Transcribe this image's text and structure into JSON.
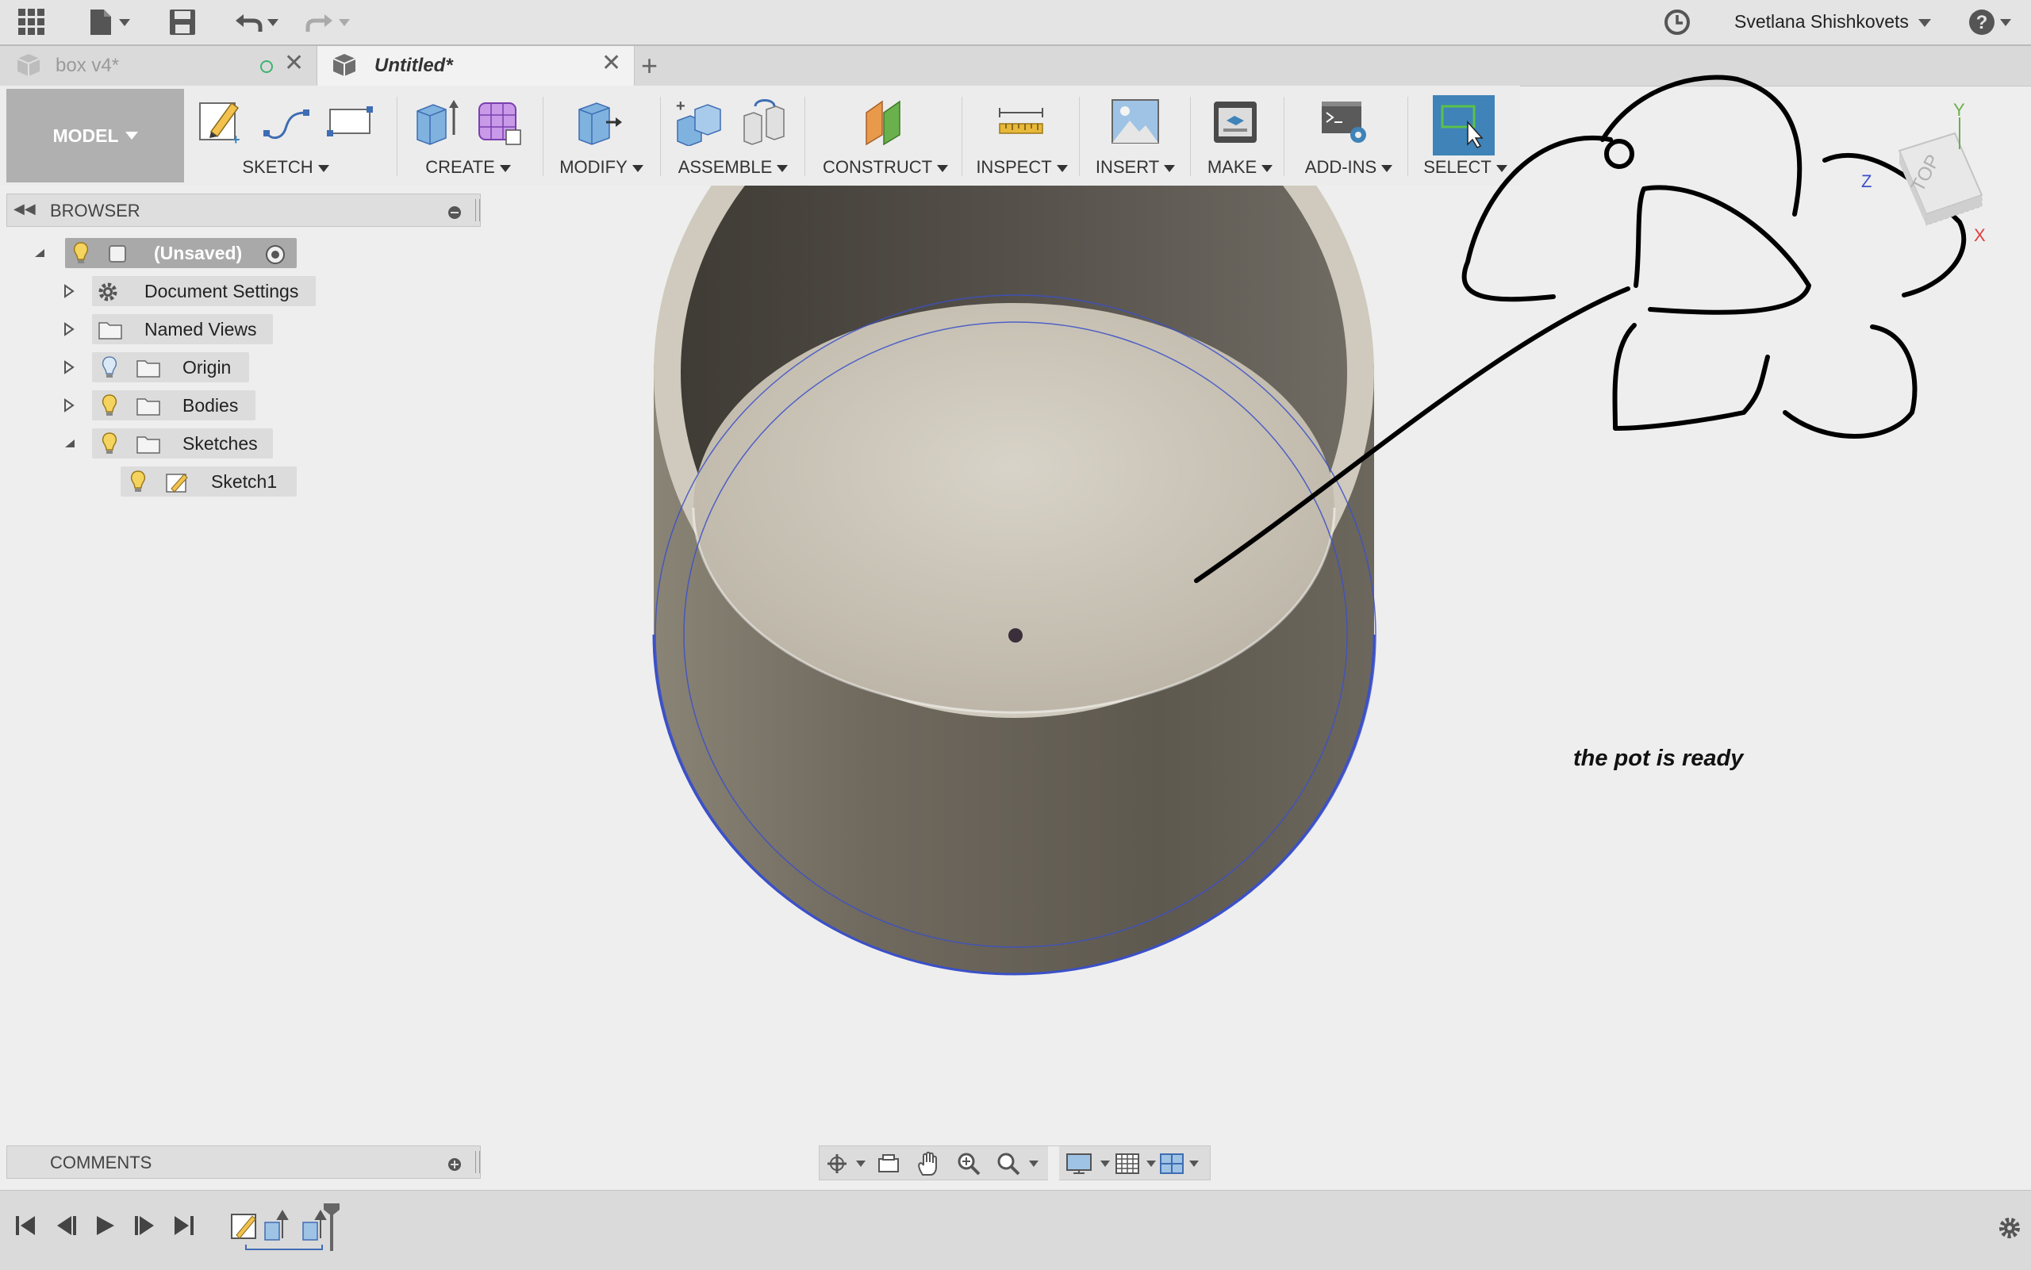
{
  "titlebar": {
    "user_name": "Svetlana Shishkovets"
  },
  "tabs": [
    {
      "label": "box v4*",
      "active": false
    },
    {
      "label": "Untitled*",
      "active": true
    }
  ],
  "workspace": {
    "label": "MODEL"
  },
  "ribbon": {
    "groups": [
      {
        "label": "SKETCH",
        "icons": [
          "create-sketch-icon",
          "spline-icon",
          "rectangle-icon"
        ]
      },
      {
        "label": "CREATE",
        "icons": [
          "extrude-icon",
          "form-icon"
        ]
      },
      {
        "label": "MODIFY",
        "icons": [
          "press-pull-icon"
        ]
      },
      {
        "label": "ASSEMBLE",
        "icons": [
          "new-component-icon",
          "joint-icon"
        ]
      },
      {
        "label": "CONSTRUCT",
        "icons": [
          "offset-plane-icon"
        ]
      },
      {
        "label": "INSPECT",
        "icons": [
          "measure-icon"
        ]
      },
      {
        "label": "INSERT",
        "icons": [
          "insert-image-icon"
        ]
      },
      {
        "label": "MAKE",
        "icons": [
          "3d-print-icon"
        ]
      },
      {
        "label": "ADD-INS",
        "icons": [
          "scripts-icon"
        ]
      },
      {
        "label": "SELECT",
        "icons": [
          "select-icon"
        ]
      }
    ]
  },
  "browser": {
    "title": "BROWSER",
    "root": "(Unsaved)",
    "items": [
      {
        "label": "Document Settings",
        "icon": "gear-icon"
      },
      {
        "label": "Named Views",
        "icon": "folder-icon"
      },
      {
        "label": "Origin",
        "icon": "folder-icon"
      },
      {
        "label": "Bodies",
        "icon": "folder-icon"
      },
      {
        "label": "Sketches",
        "icon": "folder-icon"
      },
      {
        "label": "Sketch1",
        "icon": "sketch-icon"
      }
    ]
  },
  "comments": {
    "title": "COMMENTS"
  },
  "viewcube": {
    "face_label": "TOP",
    "axes": [
      "Y",
      "Z",
      "X"
    ]
  },
  "annotation": {
    "text": "the pot is ready"
  },
  "colors": {
    "select_active": "#3f83b8",
    "sketch_line": "#3b50c8",
    "pot_outer": "#6d675d",
    "pot_inner": "#cbc5b8"
  }
}
